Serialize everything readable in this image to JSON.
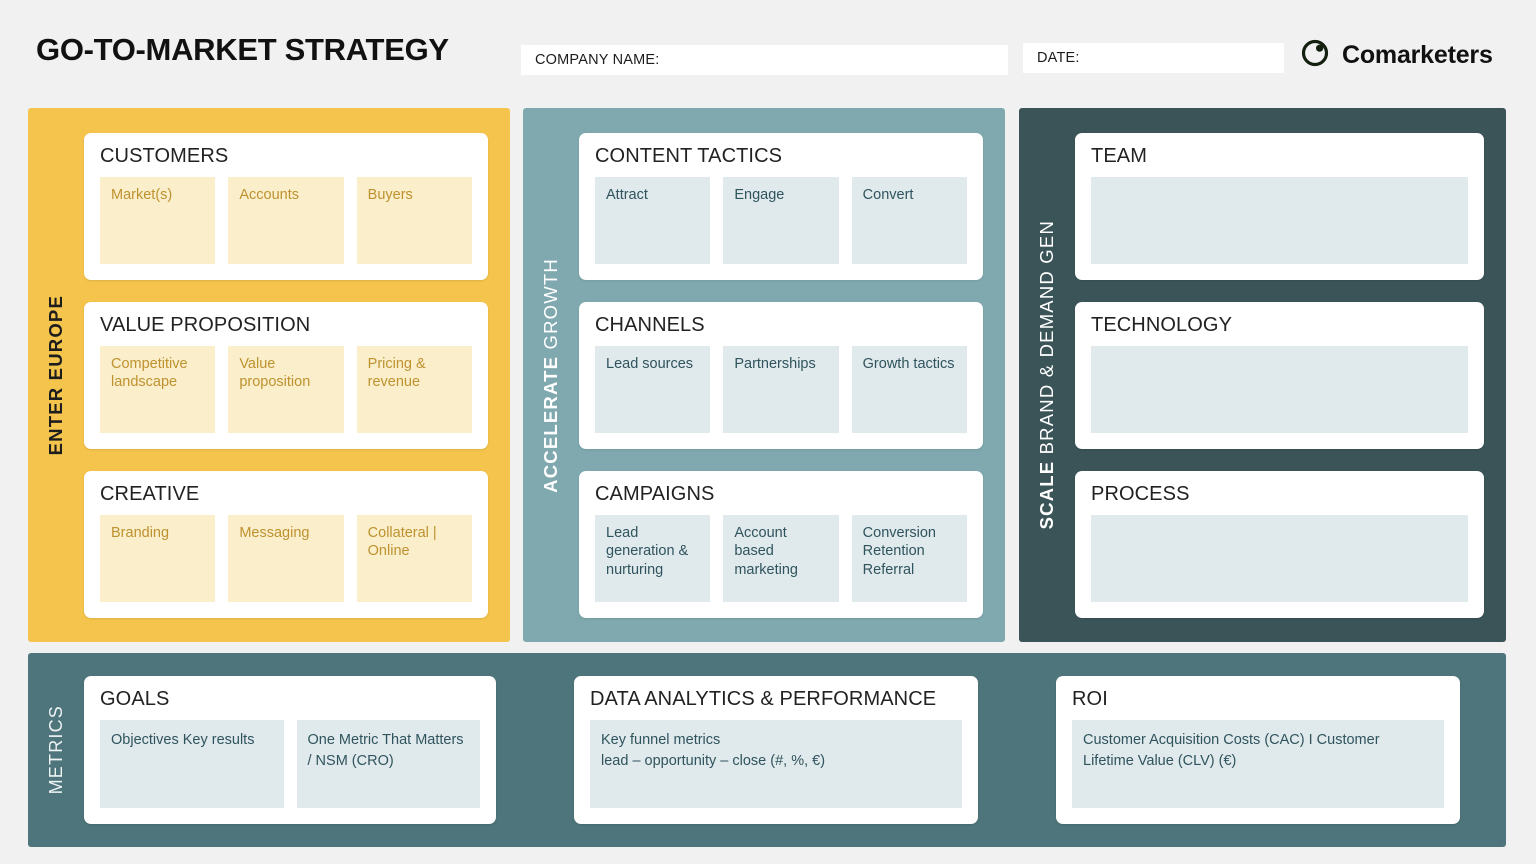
{
  "header": {
    "title": "GO-TO-MARKET STRATEGY",
    "company_label": "COMPANY NAME:",
    "date_label": "DATE:",
    "brand_name": "Comarketers",
    "brand_icon": "circle-dot-logo-icon"
  },
  "colors": {
    "page_background": "#f1f1f1",
    "enter_column": "#f4c44c",
    "enter_cell": "#fbeecb",
    "enter_cell_text": "#bd922f",
    "accelerate_column": "#7fa9af",
    "scale_column": "#3b5458",
    "metrics_band": "#4e757b",
    "blue_cell": "#e0e9eb",
    "blue_cell_text": "#2f545e",
    "card_background": "#ffffff",
    "title_text": "#111111"
  },
  "columns": [
    {
      "id": "enter-europe",
      "rail_label": "ENTER EUROPE",
      "rail_label_strong": "ENTER EUROPE",
      "rail_label_rest": "",
      "cards": [
        {
          "title": "CUSTOMERS",
          "cells": [
            "Market(s)",
            "Accounts",
            "Buyers"
          ]
        },
        {
          "title": "VALUE PROPOSITION",
          "cells": [
            "Competitive landscape",
            "Value proposition",
            "Pricing & revenue"
          ]
        },
        {
          "title": "CREATIVE",
          "cells": [
            "Branding",
            "Messaging",
            "Collateral | Online"
          ]
        }
      ]
    },
    {
      "id": "accelerate-growth",
      "rail_label": "ACCELERATE GROWTH",
      "rail_label_strong": "ACCELERATE",
      "rail_label_rest": " GROWTH",
      "cards": [
        {
          "title": "CONTENT TACTICS",
          "cells": [
            "Attract",
            "Engage",
            "Convert"
          ]
        },
        {
          "title": "CHANNELS",
          "cells": [
            "Lead sources",
            "Partnerships",
            "Growth tactics"
          ]
        },
        {
          "title": "CAMPAIGNS",
          "cells": [
            "Lead generation & nurturing",
            "Account based marketing",
            "Conversion Retention Referral"
          ]
        }
      ]
    },
    {
      "id": "scale-brand-demand-gen",
      "rail_label": "SCALE BRAND & DEMAND GEN",
      "rail_label_strong": "SCALE",
      "rail_label_rest": " BRAND & DEMAND GEN",
      "cards": [
        {
          "title": "TEAM",
          "cells": [
            ""
          ]
        },
        {
          "title": "TECHNOLOGY",
          "cells": [
            ""
          ]
        },
        {
          "title": "PROCESS",
          "cells": [
            ""
          ]
        }
      ]
    }
  ],
  "metrics": {
    "rail_label": "METRICS",
    "cards": [
      {
        "title": "GOALS",
        "cells": [
          "Objectives Key results",
          "One Metric That Matters / NSM (CRO)"
        ]
      },
      {
        "title": "DATA ANALYTICS & PERFORMANCE",
        "cells": [
          "Key funnel metrics\nlead – opportunity – close (#, %, €)"
        ]
      },
      {
        "title": "ROI",
        "cells": [
          "Customer Acquisition Costs (CAC)  I  Customer Lifetime Value (CLV) (€)"
        ]
      }
    ]
  }
}
